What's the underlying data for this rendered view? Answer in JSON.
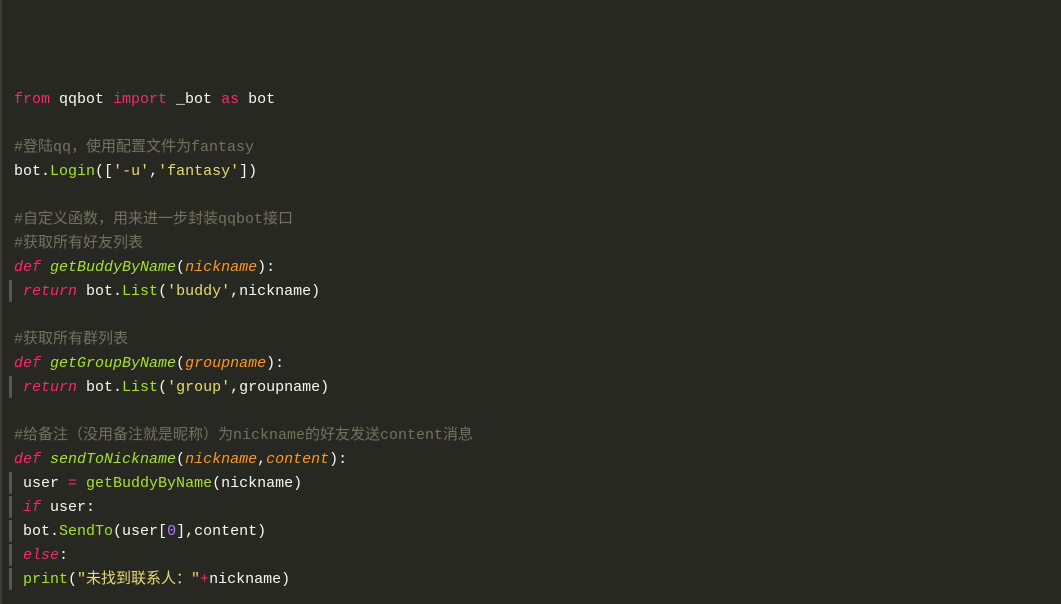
{
  "code": {
    "lines": [
      {
        "tokens": [
          {
            "t": "from ",
            "c": "kw"
          },
          {
            "t": "qqbot ",
            "c": "var"
          },
          {
            "t": "import ",
            "c": "kw"
          },
          {
            "t": "_bot ",
            "c": "var"
          },
          {
            "t": "as ",
            "c": "kw"
          },
          {
            "t": "bot",
            "c": "var"
          }
        ],
        "gutter": false
      },
      {
        "tokens": [],
        "gutter": false
      },
      {
        "tokens": [
          {
            "t": "#登陆qq，使用配置文件为fantasy",
            "c": "cmt"
          }
        ],
        "gutter": false
      },
      {
        "tokens": [
          {
            "t": "bot",
            "c": "var"
          },
          {
            "t": ".",
            "c": "var"
          },
          {
            "t": "Login",
            "c": "fn"
          },
          {
            "t": "([",
            "c": "var"
          },
          {
            "t": "'-u'",
            "c": "str"
          },
          {
            "t": ",",
            "c": "var"
          },
          {
            "t": "'fantasy'",
            "c": "str"
          },
          {
            "t": "])",
            "c": "var"
          }
        ],
        "gutter": false
      },
      {
        "tokens": [],
        "gutter": false
      },
      {
        "tokens": [
          {
            "t": "#自定义函数，用来进一步封装qqbot接口",
            "c": "cmt"
          }
        ],
        "gutter": false
      },
      {
        "tokens": [
          {
            "t": "#获取所有好友列表",
            "c": "cmt"
          }
        ],
        "gutter": false
      },
      {
        "tokens": [
          {
            "t": "def ",
            "c": "kw-it"
          },
          {
            "t": "getBuddyByName",
            "c": "fn-it"
          },
          {
            "t": "(",
            "c": "var"
          },
          {
            "t": "nickname",
            "c": "prm"
          },
          {
            "t": "):",
            "c": "var"
          }
        ],
        "gutter": false
      },
      {
        "tokens": [
          {
            "t": " return ",
            "c": "kw-it"
          },
          {
            "t": "bot",
            "c": "var"
          },
          {
            "t": ".",
            "c": "var"
          },
          {
            "t": "List",
            "c": "fn"
          },
          {
            "t": "(",
            "c": "var"
          },
          {
            "t": "'buddy'",
            "c": "str"
          },
          {
            "t": ",nickname)",
            "c": "var"
          }
        ],
        "gutter": true
      },
      {
        "tokens": [],
        "gutter": false
      },
      {
        "tokens": [
          {
            "t": "#获取所有群列表",
            "c": "cmt"
          }
        ],
        "gutter": false
      },
      {
        "tokens": [
          {
            "t": "def ",
            "c": "kw-it"
          },
          {
            "t": "getGroupByName",
            "c": "fn-it"
          },
          {
            "t": "(",
            "c": "var"
          },
          {
            "t": "groupname",
            "c": "prm"
          },
          {
            "t": "):",
            "c": "var"
          }
        ],
        "gutter": false
      },
      {
        "tokens": [
          {
            "t": " return ",
            "c": "kw-it"
          },
          {
            "t": "bot",
            "c": "var"
          },
          {
            "t": ".",
            "c": "var"
          },
          {
            "t": "List",
            "c": "fn"
          },
          {
            "t": "(",
            "c": "var"
          },
          {
            "t": "'group'",
            "c": "str"
          },
          {
            "t": ",groupname)",
            "c": "var"
          }
        ],
        "gutter": true
      },
      {
        "tokens": [],
        "gutter": false
      },
      {
        "tokens": [
          {
            "t": "#给备注（没用备注就是昵称）为nickname的好友发送content消息",
            "c": "cmt"
          }
        ],
        "gutter": false
      },
      {
        "tokens": [
          {
            "t": "def ",
            "c": "kw-it"
          },
          {
            "t": "sendToNickname",
            "c": "fn-it"
          },
          {
            "t": "(",
            "c": "var"
          },
          {
            "t": "nickname",
            "c": "prm"
          },
          {
            "t": ",",
            "c": "var"
          },
          {
            "t": "content",
            "c": "prm"
          },
          {
            "t": "):",
            "c": "var"
          }
        ],
        "gutter": false
      },
      {
        "tokens": [
          {
            "t": " user ",
            "c": "var"
          },
          {
            "t": "=",
            "c": "op"
          },
          {
            "t": " ",
            "c": "var"
          },
          {
            "t": "getBuddyByName",
            "c": "fn"
          },
          {
            "t": "(nickname)",
            "c": "var"
          }
        ],
        "gutter": true
      },
      {
        "tokens": [
          {
            "t": " if ",
            "c": "kw-it"
          },
          {
            "t": "user:",
            "c": "var"
          }
        ],
        "gutter": true
      },
      {
        "tokens": [
          {
            "t": " bot",
            "c": "var"
          },
          {
            "t": ".",
            "c": "var"
          },
          {
            "t": "SendTo",
            "c": "fn"
          },
          {
            "t": "(user[",
            "c": "var"
          },
          {
            "t": "0",
            "c": "num"
          },
          {
            "t": "],content)",
            "c": "var"
          }
        ],
        "gutter": true
      },
      {
        "tokens": [
          {
            "t": " else",
            "c": "kw-it"
          },
          {
            "t": ":",
            "c": "var"
          }
        ],
        "gutter": true
      },
      {
        "tokens": [
          {
            "t": " print",
            "c": "fn"
          },
          {
            "t": "(",
            "c": "var"
          },
          {
            "t": "\"未找到联系人：\"",
            "c": "str"
          },
          {
            "t": "+",
            "c": "op"
          },
          {
            "t": "nickname)",
            "c": "var"
          }
        ],
        "gutter": true
      }
    ]
  }
}
